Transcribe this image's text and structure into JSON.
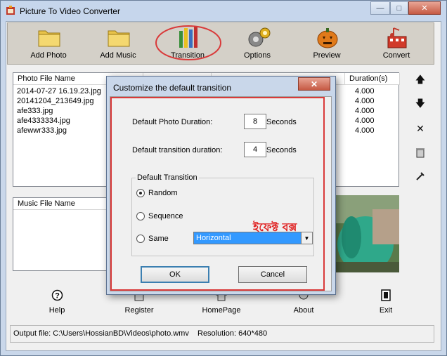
{
  "app": {
    "title": "Picture To Video Converter"
  },
  "toolbar": {
    "buttons": [
      {
        "label": "Add Photo",
        "icon": "folder-icon"
      },
      {
        "label": "Add Music",
        "icon": "folder-icon"
      },
      {
        "label": "Transition",
        "icon": "pencils-icon"
      },
      {
        "label": "Options",
        "icon": "gears-icon"
      },
      {
        "label": "Preview",
        "icon": "pumpkin-icon"
      },
      {
        "label": "Convert",
        "icon": "film-music-icon"
      }
    ]
  },
  "photo_list": {
    "headers": [
      "Photo File Name",
      "Duration(s)"
    ],
    "rows": [
      {
        "name": "2014-07-27 16.19.23.jpg",
        "duration": "4.000"
      },
      {
        "name": "20141204_213649.jpg",
        "duration": "4.000"
      },
      {
        "name": "afe333.jpg",
        "duration": "4.000"
      },
      {
        "name": "afe4333334.jpg",
        "duration": "4.000"
      },
      {
        "name": "afewwr333.jpg",
        "duration": "4.000"
      }
    ]
  },
  "side_buttons": [
    "arrow-up-icon",
    "arrow-down-icon",
    "close-x-icon",
    "trash-icon",
    "tools-icon"
  ],
  "music_list": {
    "header": "Music File Name"
  },
  "bottom_buttons": [
    {
      "label": "Help",
      "icon": "help-icon"
    },
    {
      "label": "Register",
      "icon": "register-icon"
    },
    {
      "label": "HomePage",
      "icon": "homepage-icon"
    },
    {
      "label": "About",
      "icon": "about-icon"
    },
    {
      "label": "Exit",
      "icon": "exit-icon"
    }
  ],
  "status": {
    "output": "Output file: C:\\Users\\HossianBD\\Videos\\photo.wmv",
    "resolution": "Resolution: 640*480"
  },
  "dialog": {
    "title": "Customize the default transition",
    "photo_duration_label": "Default Photo Duration:",
    "photo_duration_value": "8",
    "seconds_label": "Seconds",
    "transition_duration_label": "Default transition duration:",
    "transition_duration_value": "4",
    "group_title": "Default Transition",
    "radio_random": "Random",
    "radio_sequence": "Sequence",
    "radio_same": "Same",
    "selected_option": "Random",
    "effect_value": "Horizontal",
    "annotation": "ইফেক্ট বক্স",
    "ok_label": "OK",
    "cancel_label": "Cancel"
  },
  "colors": {
    "accent_red": "#d93a3a",
    "selection_blue": "#3399ff"
  }
}
